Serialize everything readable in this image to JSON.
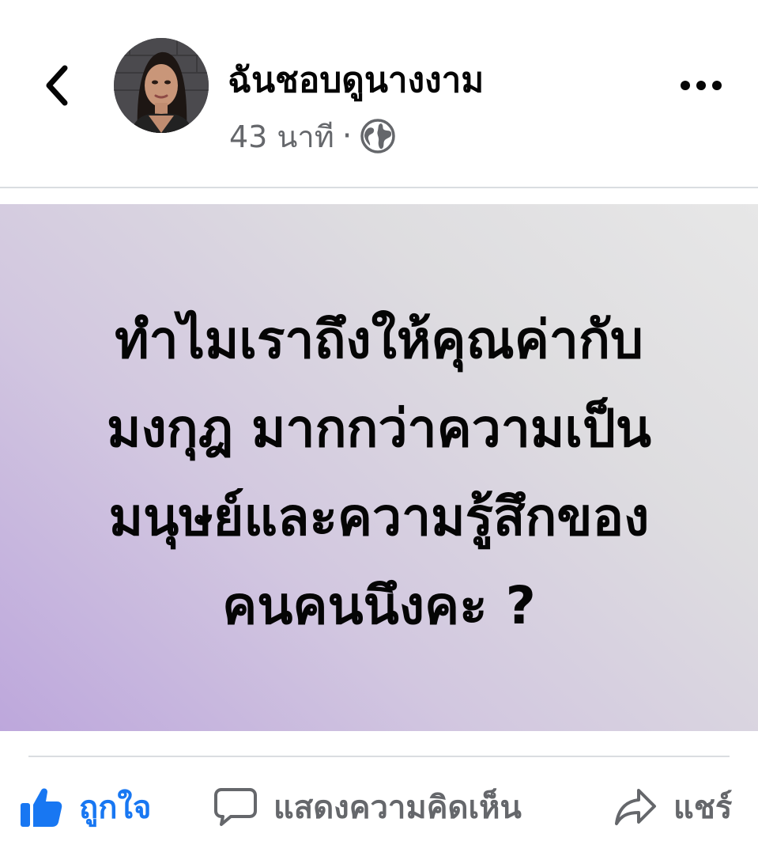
{
  "header": {
    "author_name": "ฉันชอบดูนางงาม",
    "time": "43 นาที",
    "separator": "·",
    "privacy_icon": "globe-icon",
    "back_icon": "chevron-left-icon",
    "more_icon": "more-horizontal-icon"
  },
  "post": {
    "lines": [
      "ทำไมเราถึงให้คุณค่ากับ",
      "มงกุฎ มากกว่าความเป็น",
      "มนุษย์และความรู้สึกของ",
      "คนคนนึงคะ ?"
    ],
    "background_colors": [
      "#e7e7e7",
      "#bda7dc"
    ]
  },
  "actions": {
    "like_label": "ถูกใจ",
    "comment_label": "แสดงความคิดเห็น",
    "share_label": "แชร์",
    "like_color": "#1877f2",
    "muted_color": "#65676b"
  }
}
